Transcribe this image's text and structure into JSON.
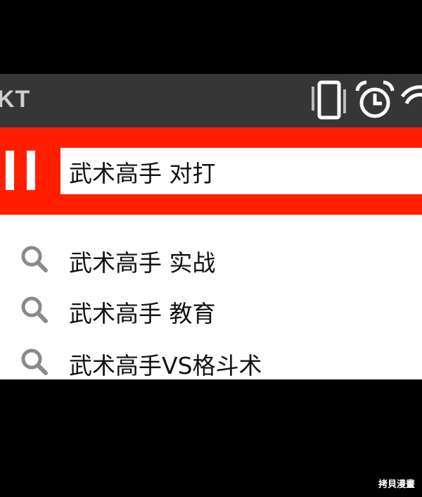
{
  "status_bar": {
    "carrier": "KT",
    "icons": [
      "vibrate-icon",
      "alarm-icon",
      "wifi-icon"
    ]
  },
  "toolbar": {
    "menu_icon": "pause-bars-icon",
    "search_query": "武术高手 对打"
  },
  "suggestions": [
    {
      "icon": "search-icon",
      "label": "武术高手 实战"
    },
    {
      "icon": "search-icon",
      "label": "武术高手 教育"
    },
    {
      "icon": "search-icon",
      "label": "武术高手VS格斗术"
    }
  ],
  "watermark": "拷貝漫畫",
  "colors": {
    "background": "#000000",
    "status_bar": "#363636",
    "toolbar": "#ff1f00",
    "search_box": "#ffffff",
    "suggestion_text": "#111111",
    "icon_gray": "#8a8a8a"
  }
}
